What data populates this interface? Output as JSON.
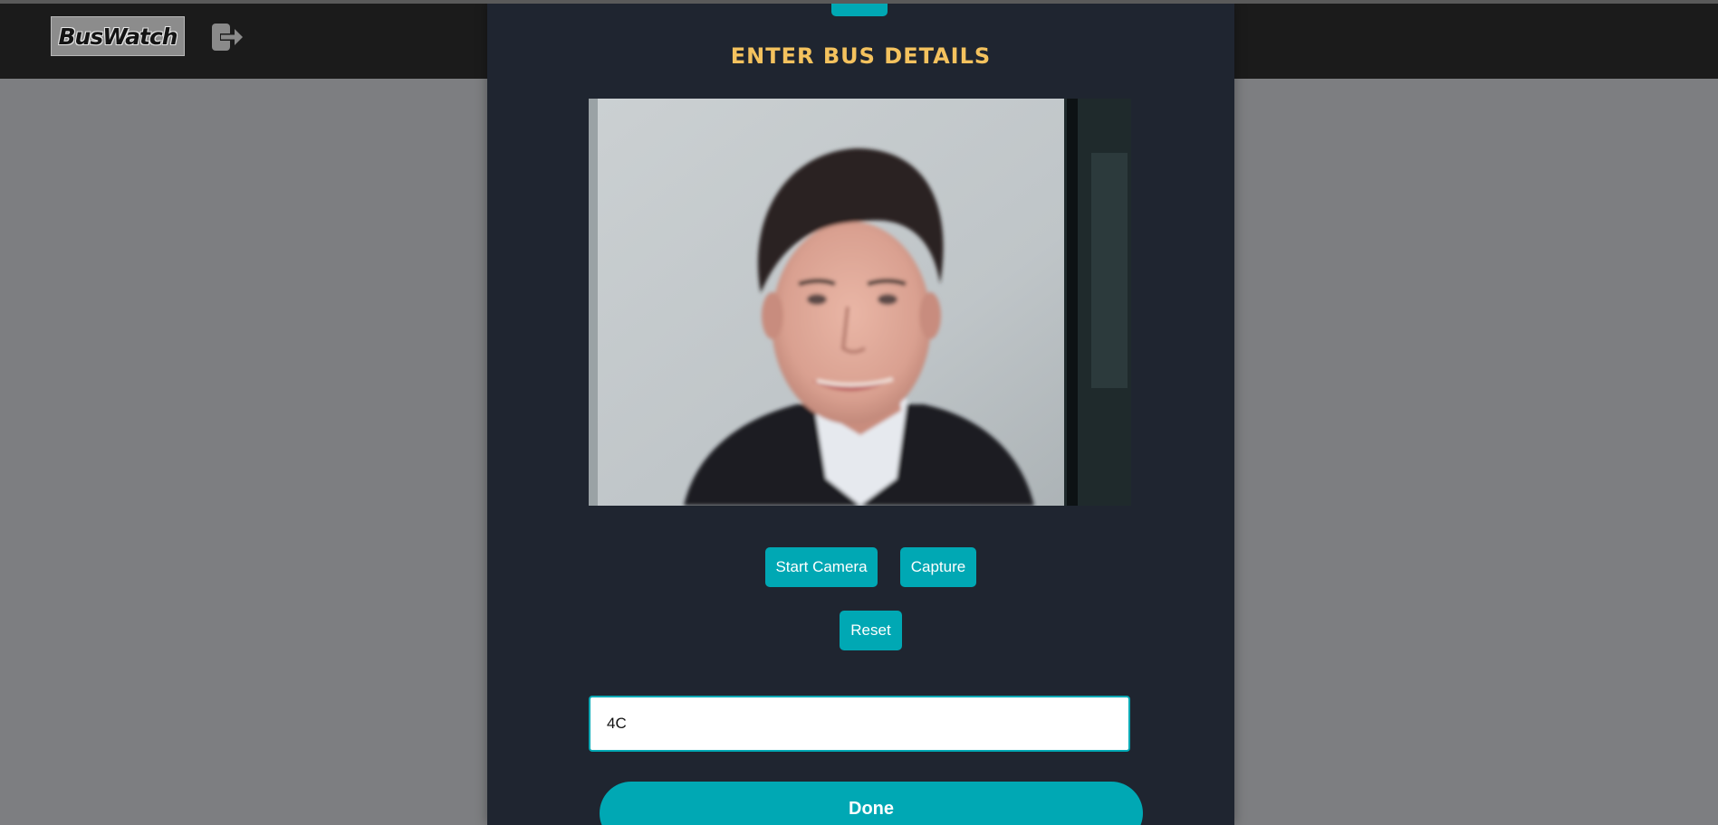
{
  "navbar": {
    "logo_text": "BusWatch",
    "logout_icon": "logout-icon"
  },
  "modal": {
    "title": "ENTER BUS DETAILS",
    "camera_preview": "camera-preview-image",
    "buttons": {
      "start_camera": "Start Camera",
      "capture": "Capture",
      "reset": "Reset"
    },
    "bus_input": {
      "value": "4C",
      "placeholder": ""
    },
    "done_label": "Done"
  },
  "colors": {
    "accent": "#00a8b4",
    "title": "#f4c25e",
    "modal_bg": "#1f2530",
    "navbar_bg": "#1b1b1b",
    "overlay_bg": "#7d7e81"
  }
}
